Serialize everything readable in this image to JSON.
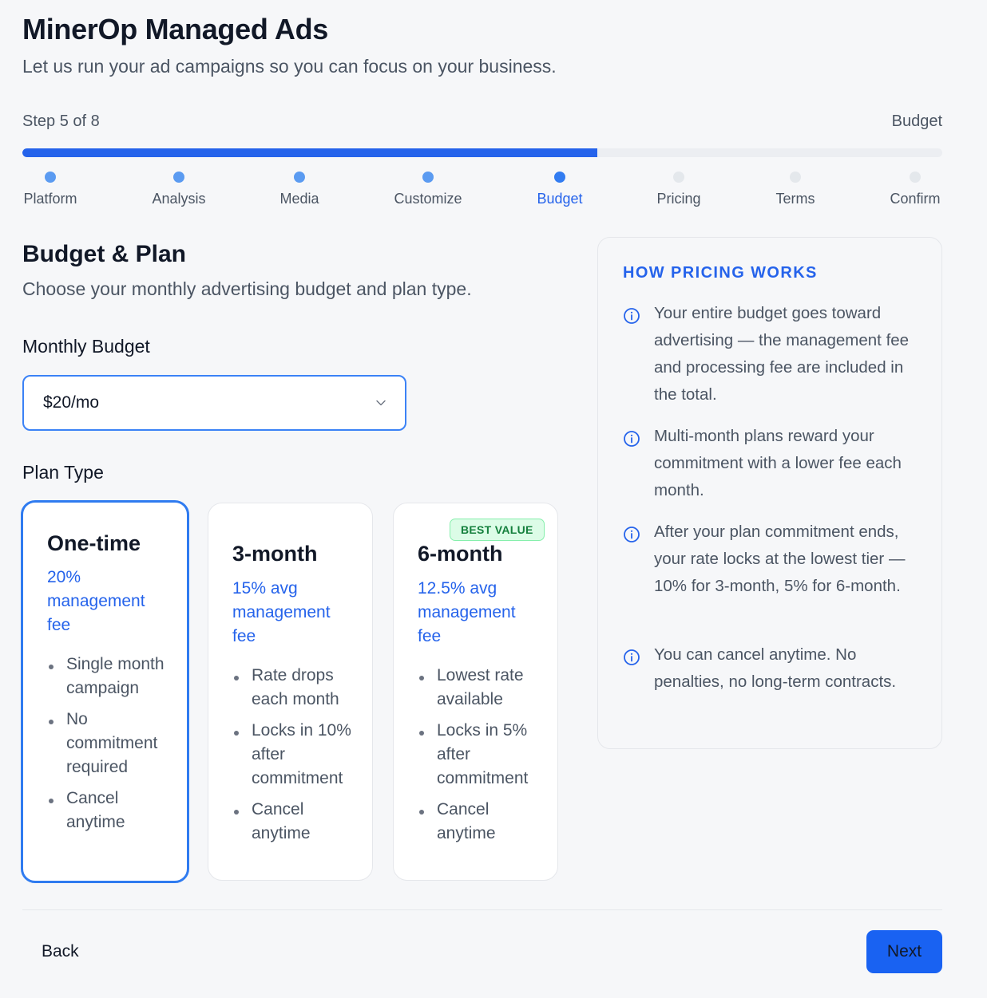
{
  "header": {
    "title": "MinerOp Managed Ads",
    "subtitle": "Let us run your ad campaigns so you can focus on your business."
  },
  "progress": {
    "step_label": "Step 5 of 8",
    "step_name": "Budget",
    "fraction": 0.625,
    "steps": [
      {
        "label": "Platform",
        "state": "done"
      },
      {
        "label": "Analysis",
        "state": "done"
      },
      {
        "label": "Media",
        "state": "done"
      },
      {
        "label": "Customize",
        "state": "done"
      },
      {
        "label": "Budget",
        "state": "current"
      },
      {
        "label": "Pricing",
        "state": "todo"
      },
      {
        "label": "Terms",
        "state": "todo"
      },
      {
        "label": "Confirm",
        "state": "todo"
      }
    ]
  },
  "section": {
    "title": "Budget & Plan",
    "subtitle": "Choose your monthly advertising budget and plan type."
  },
  "budget": {
    "label": "Monthly Budget",
    "value": "$20/mo",
    "icon": "chevron-down-icon"
  },
  "plans": {
    "label": "Plan Type",
    "items": [
      {
        "name": "One-time",
        "fee": "20% management fee",
        "features": [
          "Single month campaign",
          "No commitment required",
          "Cancel anytime"
        ],
        "selected": true
      },
      {
        "name": "3-month",
        "fee": "15% avg management fee",
        "features": [
          "Rate drops each month",
          "Locks in 10% after commitment",
          "Cancel anytime"
        ],
        "selected": false
      },
      {
        "name": "6-month",
        "badge": "BEST VALUE",
        "fee": "12.5% avg management fee",
        "features": [
          "Lowest rate available",
          "Locks in 5% after commitment",
          "Cancel anytime"
        ],
        "selected": false
      }
    ]
  },
  "info": {
    "title": "HOW PRICING WORKS",
    "items": [
      "Your entire budget goes toward advertising — the management fee and processing fee are included in the total.",
      "Multi-month plans reward your commitment with a lower fee each month.",
      "After your plan commitment ends, your rate locks at the lowest tier — 10% for 3-month, 5% for 6-month.",
      "You can cancel anytime. No penalties, no long-term contracts."
    ]
  },
  "footer": {
    "back_label": "Back",
    "next_label": "Next"
  },
  "colors": {
    "accent": "#2563eb",
    "badge_green": "#15803d",
    "next_button": "#1962f2"
  }
}
